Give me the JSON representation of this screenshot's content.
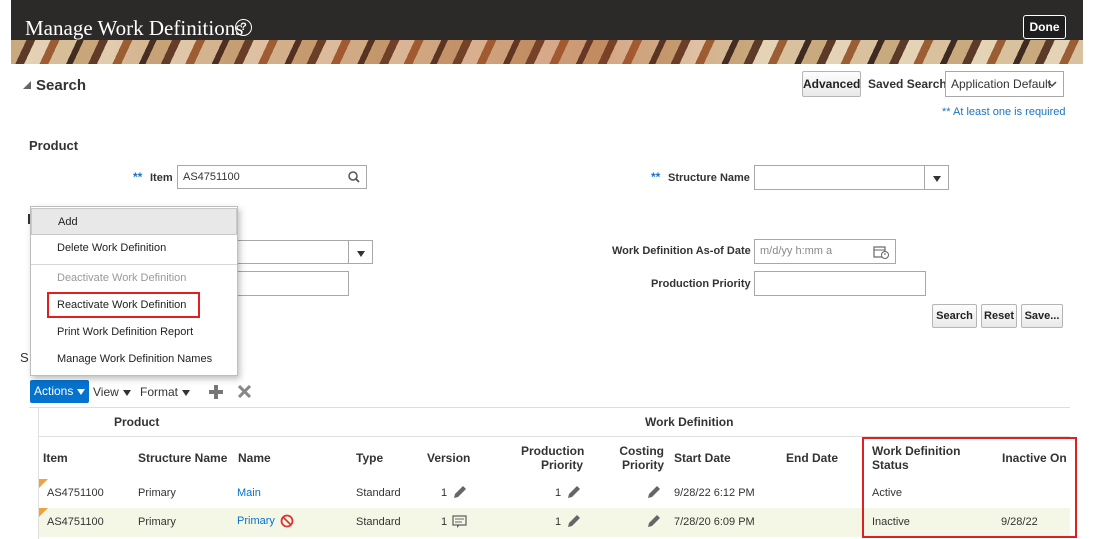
{
  "header": {
    "title": "Manage Work Definitions",
    "help_icon": "?",
    "done_label": "Done"
  },
  "search": {
    "section_title": "Search",
    "advanced_label": "Advanced",
    "saved_search_label": "Saved Search",
    "saved_search_value": "Application Default",
    "required_note": "** At least one is required",
    "product_label": "Product",
    "item_label": "Item",
    "item_value": "AS4751100",
    "structure_name_label": "Structure Name",
    "structure_name_value": "",
    "required_marker": "**",
    "asof_label": "Work Definition As-of Date",
    "asof_placeholder": "m/d/yy h:mm a",
    "production_priority_label": "Production Priority",
    "search_btn": "Search",
    "reset_btn": "Reset",
    "save_btn": "Save..."
  },
  "menu": {
    "items": [
      {
        "label": "Add"
      },
      {
        "label": "Delete Work Definition"
      },
      {
        "label": "Deactivate Work Definition"
      },
      {
        "label": "Reactivate Work Definition"
      },
      {
        "label": "Print Work Definition Report"
      },
      {
        "label": "Manage Work Definition Names"
      }
    ]
  },
  "toolbar": {
    "actions": "Actions",
    "view": "View",
    "format": "Format",
    "partial_letter": "S"
  },
  "table": {
    "group_product": "Product",
    "group_work_definition": "Work Definition",
    "columns": {
      "item": "Item",
      "structure_name": "Structure Name",
      "name": "Name",
      "type": "Type",
      "version": "Version",
      "production_priority_1": "Production",
      "production_priority_2": "Priority",
      "costing_priority_1": "Costing",
      "costing_priority_2": "Priority",
      "start_date": "Start Date",
      "end_date": "End Date",
      "status_1": "Work Definition",
      "status_2": "Status",
      "inactive_on": "Inactive On"
    },
    "rows": [
      {
        "item": "AS4751100",
        "structure_name": "Primary",
        "name": "Main",
        "type": "Standard",
        "version": "1",
        "production_priority": "1",
        "start_date": "9/28/22 6:12 PM",
        "end_date": "",
        "status": "Active",
        "inactive_on": ""
      },
      {
        "item": "AS4751100",
        "structure_name": "Primary",
        "name": "Primary",
        "type": "Standard",
        "version": "1",
        "production_priority": "1",
        "start_date": "7/28/20 6:09 PM",
        "end_date": "",
        "status": "Inactive",
        "inactive_on": "9/28/22"
      }
    ]
  },
  "colors": {
    "accent": "#0572ce",
    "highlight_box": "#e02020",
    "header_bg": "#2c2a28"
  }
}
